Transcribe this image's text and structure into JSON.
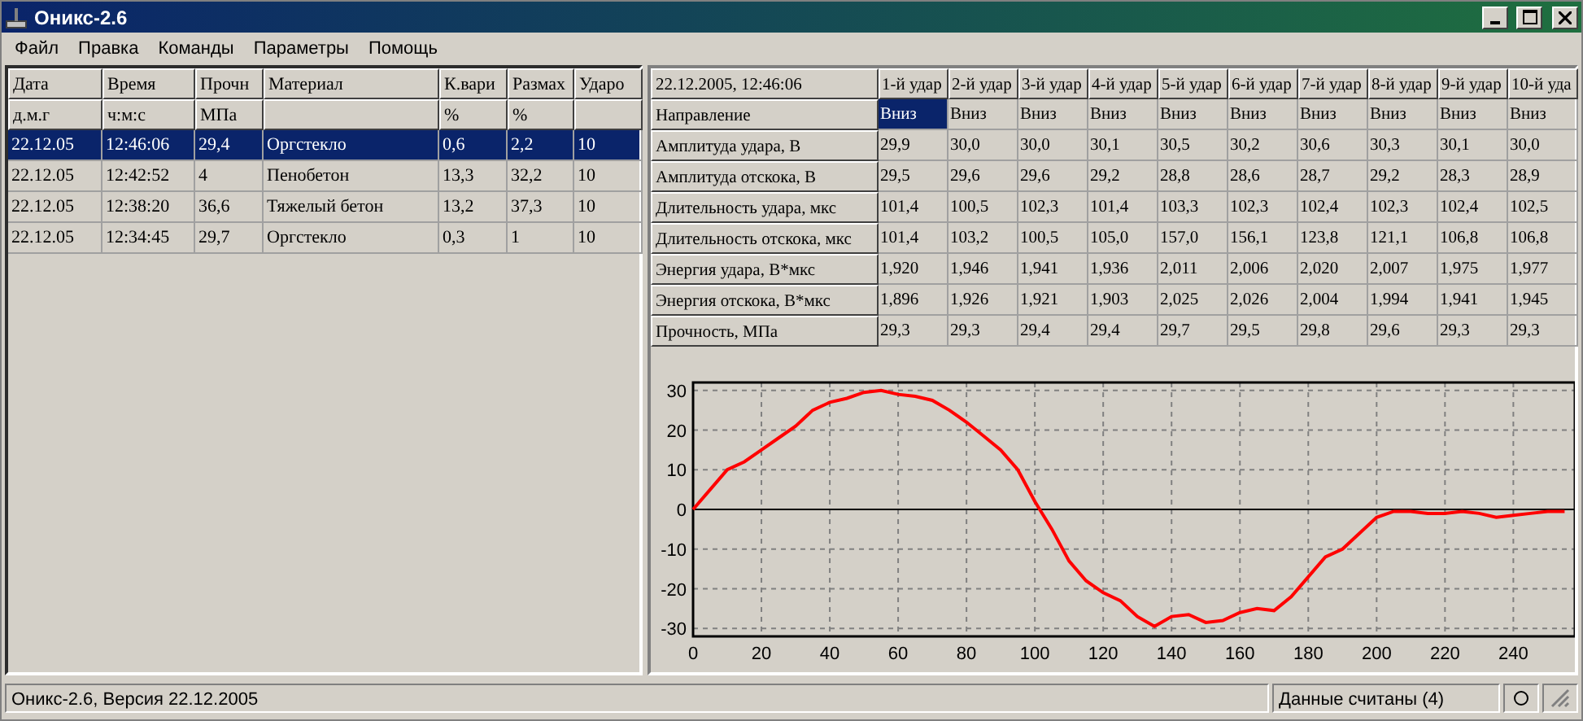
{
  "window": {
    "title": "Оникс-2.6"
  },
  "menu": [
    "Файл",
    "Правка",
    "Команды",
    "Параметры",
    "Помощь"
  ],
  "records": {
    "columns": [
      {
        "label": "Дата",
        "unit": "д.м.г"
      },
      {
        "label": "Время",
        "unit": "ч:м:с"
      },
      {
        "label": "Прочн",
        "unit": "МПа"
      },
      {
        "label": "Материал"
      },
      {
        "label": "К.вари",
        "unit": "%"
      },
      {
        "label": "Размах",
        "unit": "%"
      },
      {
        "label": "Ударо"
      }
    ],
    "rows": [
      {
        "selected": true,
        "cells": [
          "22.12.05",
          "12:46:06",
          "29,4",
          "Оргстекло",
          "0,6",
          "2,2",
          "10"
        ]
      },
      {
        "selected": false,
        "cells": [
          "22.12.05",
          "12:42:52",
          "4",
          "Пенобетон",
          "13,3",
          "32,2",
          "10"
        ]
      },
      {
        "selected": false,
        "cells": [
          "22.12.05",
          "12:38:20",
          "36,6",
          "Тяжелый бетон",
          "13,2",
          "37,3",
          "10"
        ]
      },
      {
        "selected": false,
        "cells": [
          "22.12.05",
          "12:34:45",
          "29,7",
          "Оргстекло",
          "0,3",
          "1",
          "10"
        ]
      }
    ]
  },
  "impacts": {
    "caption": "22.12.2005, 12:46:06",
    "columns": [
      "1-й удар",
      "2-й удар",
      "3-й удар",
      "4-й удар",
      "5-й удар",
      "6-й удар",
      "7-й удар",
      "8-й удар",
      "9-й удар",
      "10-й уда"
    ],
    "direction": {
      "label": "Направление",
      "cells": [
        {
          "text": "Вниз",
          "selected": true
        },
        {
          "text": "Вниз",
          "selected": false
        },
        {
          "text": "Вниз",
          "selected": false
        },
        {
          "text": "Вниз",
          "selected": false
        },
        {
          "text": "Вниз",
          "selected": false
        },
        {
          "text": "Вниз",
          "selected": false
        },
        {
          "text": "Вниз",
          "selected": false
        },
        {
          "text": "Вниз",
          "selected": false
        },
        {
          "text": "Вниз",
          "selected": false
        },
        {
          "text": "Вниз",
          "selected": false
        }
      ]
    },
    "rows": [
      {
        "label": "Амплитуда удара, В",
        "cells": [
          "29,9",
          "30,0",
          "30,0",
          "30,1",
          "30,5",
          "30,2",
          "30,6",
          "30,3",
          "30,1",
          "30,0"
        ]
      },
      {
        "label": "Амплитуда отскока, В",
        "cells": [
          "29,5",
          "29,6",
          "29,6",
          "29,2",
          "28,8",
          "28,6",
          "28,7",
          "29,2",
          "28,3",
          "28,9"
        ]
      },
      {
        "label": "Длительность удара, мкс",
        "cells": [
          "101,4",
          "100,5",
          "102,3",
          "101,4",
          "103,3",
          "102,3",
          "102,4",
          "102,3",
          "102,4",
          "102,5"
        ]
      },
      {
        "label": "Длительность отскока, мкс",
        "cells": [
          "101,4",
          "103,2",
          "100,5",
          "105,0",
          "157,0",
          "156,1",
          "123,8",
          "121,1",
          "106,8",
          "106,8"
        ]
      },
      {
        "label": "Энергия удара, В*мкс",
        "cells": [
          "1,920",
          "1,946",
          "1,941",
          "1,936",
          "2,011",
          "2,006",
          "2,020",
          "2,007",
          "1,975",
          "1,977"
        ]
      },
      {
        "label": "Энергия отскока, В*мкс",
        "cells": [
          "1,896",
          "1,926",
          "1,921",
          "1,903",
          "2,025",
          "2,026",
          "2,004",
          "1,994",
          "1,941",
          "1,945"
        ]
      },
      {
        "label": "Прочность, МПа",
        "cells": [
          "29,3",
          "29,3",
          "29,4",
          "29,4",
          "29,7",
          "29,5",
          "29,8",
          "29,6",
          "29,3",
          "29,3"
        ]
      }
    ]
  },
  "signal": {
    "chart_data": {
      "type": "line",
      "x": [
        0,
        5,
        10,
        15,
        20,
        25,
        30,
        35,
        40,
        45,
        50,
        55,
        60,
        65,
        70,
        75,
        80,
        85,
        90,
        95,
        100,
        105,
        110,
        115,
        120,
        125,
        130,
        135,
        140,
        145,
        150,
        155,
        160,
        165,
        170,
        175,
        180,
        185,
        190,
        195,
        200,
        205,
        210,
        215,
        220,
        225,
        230,
        235,
        240,
        245,
        250,
        255
      ],
      "series": [
        {
          "color": "#ff0000",
          "values": [
            0,
            5,
            10,
            12,
            15,
            18,
            21,
            25,
            27,
            28,
            29.5,
            30,
            29,
            28.5,
            27.5,
            25,
            22,
            18.5,
            15,
            10,
            2,
            -5,
            -13,
            -18,
            -21,
            -23,
            -27,
            -29.5,
            -27,
            -26.5,
            -28.5,
            -28,
            -26,
            -25,
            -25.5,
            -22,
            -17,
            -12,
            -10,
            -6,
            -2,
            -0.5,
            -0.5,
            -1,
            -1,
            -0.5,
            -1,
            -2,
            -1.5,
            -1,
            -0.5,
            -0.5
          ]
        }
      ],
      "xlim": [
        0,
        258
      ],
      "ylim": [
        -32,
        32
      ],
      "xticks": [
        0,
        20,
        40,
        60,
        80,
        100,
        120,
        140,
        160,
        180,
        200,
        220,
        240
      ],
      "yticks": [
        -30,
        -20,
        -10,
        0,
        10,
        20,
        30
      ],
      "grid": true
    }
  },
  "status_bar": {
    "left": "Оникс-2.6, Версия 22.12.2005",
    "right": "Данные считаны (4)"
  }
}
